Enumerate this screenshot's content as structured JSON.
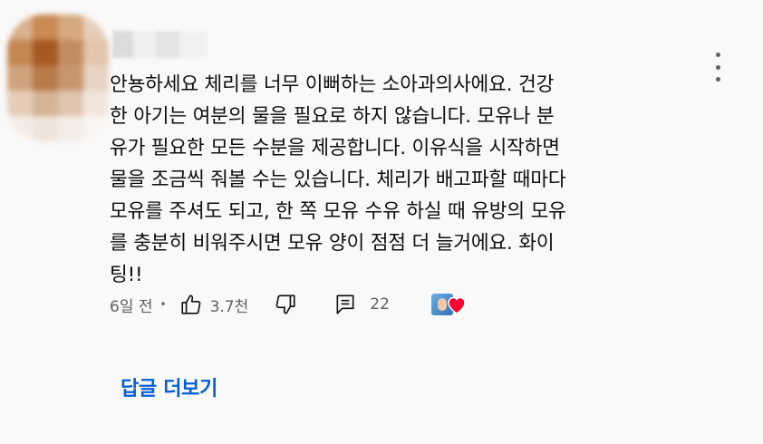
{
  "comment": {
    "text": "안뇽하세요 체리를 너무 이뻐하는 소아과의사에요. 건강\n한 아기는 여분의 물을 필요로 하지 않습니다. 모유나 분\n유가 필요한 모든 수분을 제공합니다. 이유식을 시작하면\n물을 조금씩 줘볼 수는 있습니다. 체리가 배고파할 때마다\n모유를 주셔도 되고, 한 쪽 모유 수유 하실 때 유방의 모유\n를 충분히 비워주시면 모유 양이 점점 더 늘거에요. 화이\n팅!!",
    "time": "6일 전",
    "separator": "•",
    "like_count": "3.7천",
    "reply_count": "22"
  },
  "replies_label": "답글 더보기",
  "colors": {
    "link": "#065fd4",
    "secondary_text": "#606060",
    "heart": "#ff0033"
  },
  "icons": {
    "menu": "more-vert-icon",
    "like": "thumb-up-icon",
    "dislike": "thumb-down-icon",
    "reply": "comment-icon",
    "creator_heart": "heart-icon"
  }
}
